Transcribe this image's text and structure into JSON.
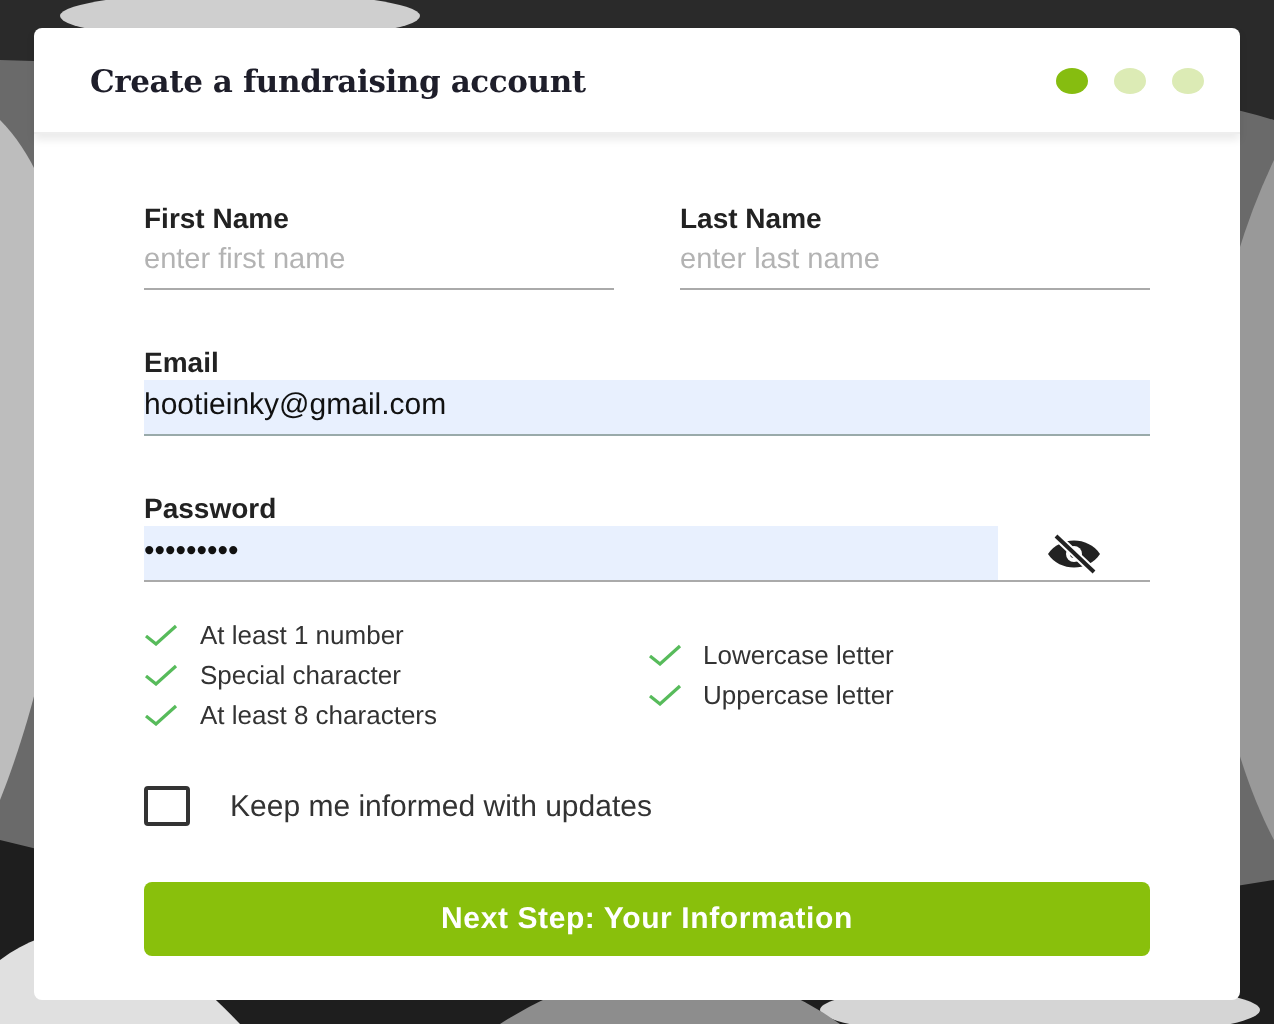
{
  "background": {
    "kind": "picture"
  },
  "title": "Create a fundraising account",
  "steps": [
    {
      "selected": true
    },
    {
      "selected": false
    },
    {
      "selected": false
    }
  ],
  "name_fields": [
    {
      "label": "First Name",
      "placeholder": "enter first name"
    },
    {
      "label": "Last Name",
      "placeholder": "enter last name"
    }
  ],
  "email": {
    "label": "Email",
    "value": "hootieinky@gmail.com"
  },
  "password": {
    "label": "Password",
    "value": "•••••••••",
    "visible": false
  },
  "requirements": [
    [
      {
        "label": "At least 1 number",
        "met": true
      },
      {
        "label": "Special character",
        "met": true
      },
      {
        "label": "At least 8 characters",
        "met": true
      }
    ],
    [
      {
        "label": "Lowercase letter",
        "met": true
      },
      {
        "label": "Uppercase letter",
        "met": true
      }
    ]
  ],
  "keep_informed": {
    "label": "Keep me informed with updates",
    "checked": false
  },
  "button": "Next Step: Your Information"
}
